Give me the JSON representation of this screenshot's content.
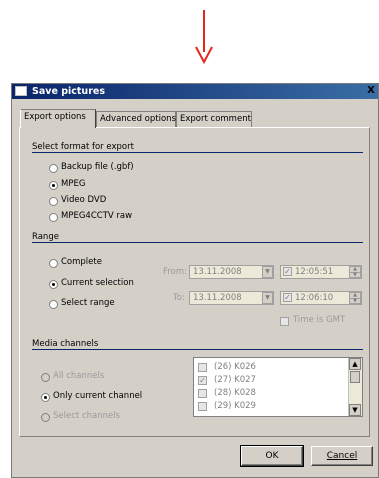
{
  "dialog": {
    "title": "Save pictures",
    "close_glyph": "X"
  },
  "tabs": [
    {
      "label": "Export options",
      "active": true
    },
    {
      "label": "Advanced options",
      "active": false
    },
    {
      "label": "Export comment",
      "active": false
    }
  ],
  "format": {
    "title": "Select format for export",
    "options": [
      {
        "label": "Backup file (.gbf)",
        "checked": false
      },
      {
        "label": "MPEG",
        "checked": true
      },
      {
        "label": "Video DVD",
        "checked": false
      },
      {
        "label": "MPEG4CCTV raw",
        "checked": false
      }
    ]
  },
  "range": {
    "title": "Range",
    "options": [
      {
        "label": "Complete",
        "checked": false
      },
      {
        "label": "Current selection",
        "checked": true
      },
      {
        "label": "Select range",
        "checked": false
      }
    ],
    "from_label": "From:",
    "from_date": "13.11.2008",
    "from_time": "12:05:51",
    "to_label": "To:",
    "to_date": "13.11.2008",
    "to_time": "12:06:10",
    "gmt_label": "Time is GMT"
  },
  "media": {
    "title": "Media channels",
    "options": [
      {
        "label": "All channels",
        "checked": false,
        "enabled": false
      },
      {
        "label": "Only current channel",
        "checked": true,
        "enabled": true
      },
      {
        "label": "Select channels",
        "checked": false,
        "enabled": false
      }
    ],
    "channels": [
      {
        "label": "(26) K026",
        "checked": false
      },
      {
        "label": "(27) K027",
        "checked": true
      },
      {
        "label": "(28) K028",
        "checked": false
      },
      {
        "label": "(29) K029",
        "checked": false
      }
    ]
  },
  "buttons": {
    "ok": "OK",
    "cancel": "Cancel"
  },
  "colors": {
    "arrow": "#e8251c",
    "title_bar": "#0a246a",
    "dialog_bg": "#d4d0c8"
  }
}
